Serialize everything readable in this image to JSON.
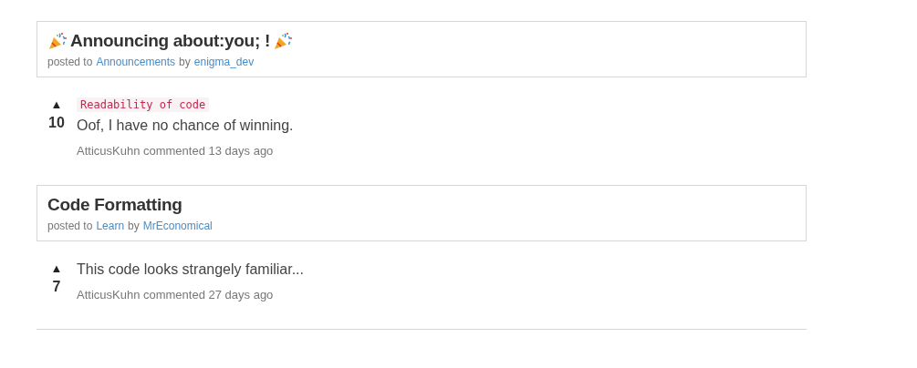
{
  "posts": [
    {
      "title": "Announcing about:you; !",
      "party_icons": true,
      "posted_to": "posted to",
      "category": "Announcements",
      "by": "by",
      "author": "enigma_dev",
      "comments": [
        {
          "vote": "▲",
          "score": "10",
          "body": [
            {
              "kind": "code",
              "text": "Readability of code"
            },
            {
              "kind": "text",
              "text": "Oof, I have no chance of winning."
            }
          ],
          "meta": "AtticusKuhn commented 13 days ago"
        }
      ]
    },
    {
      "title": "Code Formatting",
      "party_icons": false,
      "posted_to": "posted to",
      "category": "Learn",
      "by": "by",
      "author": "MrEconomical",
      "comments": [
        {
          "vote": "▲",
          "score": "7",
          "body": [
            {
              "kind": "text",
              "text": "This code looks strangely familiar..."
            }
          ],
          "meta": "AtticusKuhn commented 27 days ago"
        }
      ]
    }
  ]
}
